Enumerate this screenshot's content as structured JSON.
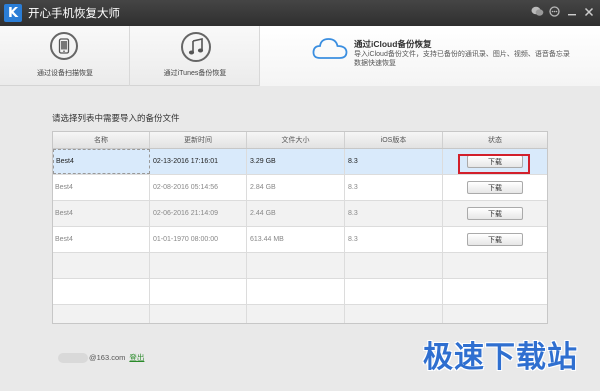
{
  "window": {
    "title": "开心手机恢复大师",
    "logo_letter": "K"
  },
  "tabs": [
    {
      "label": "通过设备扫描恢复",
      "icon": "phone-icon"
    },
    {
      "label": "通过iTunes备份恢复",
      "icon": "music-note-icon"
    },
    {
      "title": "通过iCloud备份恢复",
      "description": "导入iCloud备份文件，支持已备份的通讯录、图片、视频、语音备忘录数据快速恢复",
      "icon": "cloud-icon"
    }
  ],
  "main": {
    "prompt": "请选择列表中需要导入的备份文件",
    "columns": [
      "名称",
      "更新时间",
      "文件大小",
      "iOS版本",
      "状态"
    ],
    "rows": [
      {
        "name": "Best4",
        "updated": "02-13-2016 17:16:01",
        "size": "3.29 GB",
        "ios": "8.3",
        "action": "下载"
      },
      {
        "name": "Best4",
        "updated": "02-08-2016 05:14:56",
        "size": "2.84 GB",
        "ios": "8.3",
        "action": "下载"
      },
      {
        "name": "Best4",
        "updated": "02-06-2016 21:14:09",
        "size": "2.44 GB",
        "ios": "8.3",
        "action": "下载"
      },
      {
        "name": "Best4",
        "updated": "01-01-1970 08:00:00",
        "size": "613.44 MB",
        "ios": "8.3",
        "action": "下载"
      }
    ]
  },
  "footer": {
    "account_suffix": "@163.com",
    "logout_label": "登出",
    "watermark": "极速下载站"
  },
  "colors": {
    "accent": "#2f6fd0",
    "highlight": "#d21f2b",
    "selected_row": "#d9eafb"
  }
}
